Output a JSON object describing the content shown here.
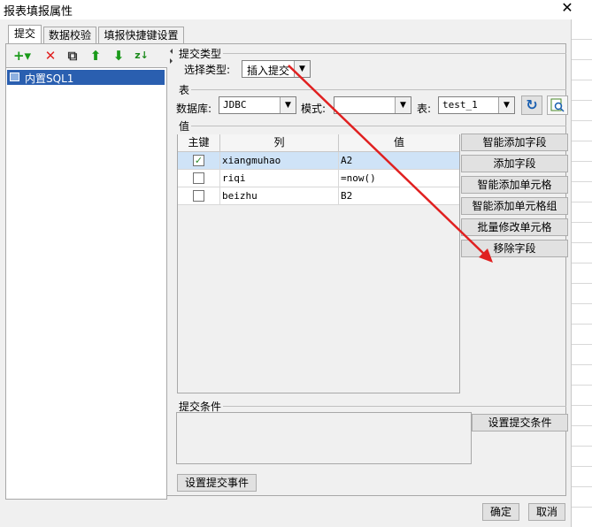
{
  "window": {
    "title": "报表填报属性",
    "close_glyph": "✕"
  },
  "tabs": [
    {
      "label": "提交",
      "active": true
    },
    {
      "label": "数据校验",
      "active": false
    },
    {
      "label": "填报快捷键设置",
      "active": false
    }
  ],
  "toolbar": {
    "add_glyph": "+▾",
    "delete_glyph": "✕",
    "copy_glyph": "⧉",
    "up_glyph": "⬆",
    "down_glyph": "⬇",
    "sort_glyph": "z↓"
  },
  "tree": {
    "items": [
      {
        "label": "内置SQL1",
        "selected": true
      }
    ]
  },
  "submit_type": {
    "group_label": "提交类型",
    "select_label": "选择类型:",
    "select_value": "插入提交"
  },
  "table_section": {
    "group_label": "表",
    "db_label": "数据库:",
    "db_value": "JDBC",
    "schema_label": "模式:",
    "schema_value": "",
    "table_label": "表:",
    "table_value": "test_1"
  },
  "values_section": {
    "group_label": "值",
    "headers": {
      "key": "主键",
      "column": "列",
      "value": "值"
    },
    "rows": [
      {
        "key": true,
        "column": "xiangmuhao",
        "value": "A2"
      },
      {
        "key": false,
        "column": "riqi",
        "value": "=now()"
      },
      {
        "key": false,
        "column": "beizhu",
        "value": "B2"
      }
    ],
    "buttons": {
      "smart_add_field": "智能添加字段",
      "add_field": "添加字段",
      "smart_add_cell": "智能添加单元格",
      "smart_add_cell_group": "智能添加单元格组",
      "batch_modify_cell": "批量修改单元格",
      "remove_field": "移除字段"
    }
  },
  "condition_section": {
    "group_label": "提交条件",
    "set_button": "设置提交条件"
  },
  "event_button": "设置提交事件",
  "footer": {
    "ok": "确定",
    "cancel": "取消"
  },
  "colors": {
    "accent": "#2a5fb0",
    "annotation_arrow": "#e02020"
  }
}
